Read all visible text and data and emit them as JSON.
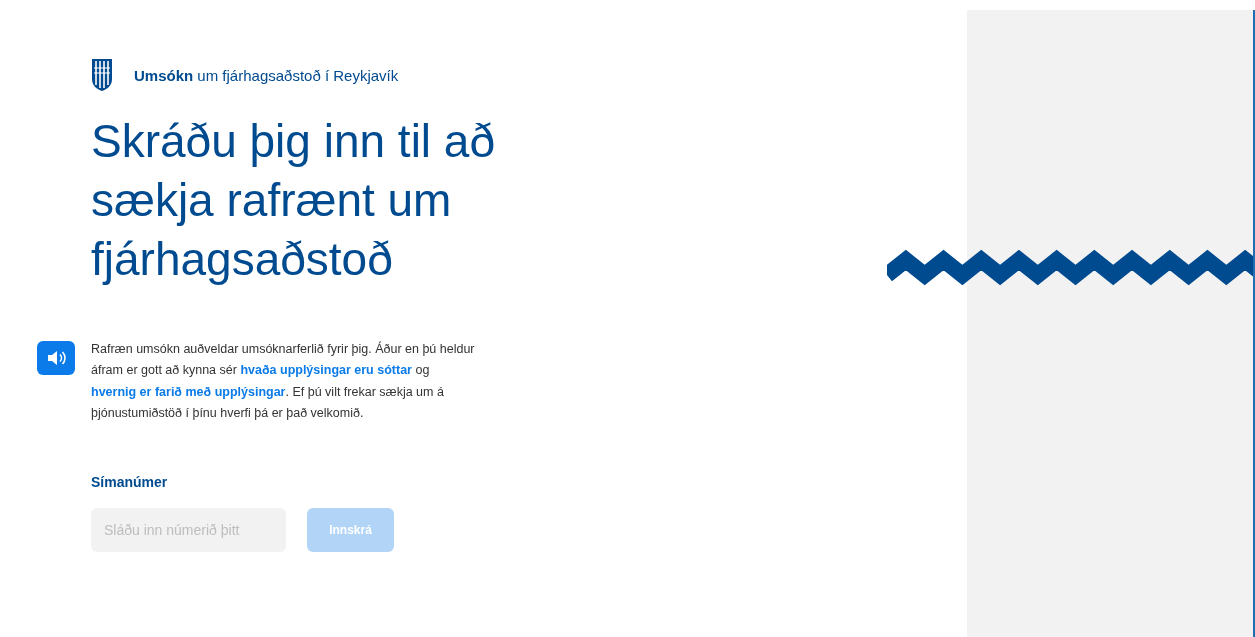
{
  "header": {
    "brand_bold": "Umsókn",
    "brand_rest": "um fjárhagsaðstoð í Reykjavík"
  },
  "title": "Skráðu þig inn til að sækja rafrænt um fjárhagsaðstoð",
  "intro": [
    {
      "kind": "text",
      "text": "Rafræn umsókn auðveldar umsóknarferlið fyrir þig. Áður en þú heldur áfram er gott að kynna sér "
    },
    {
      "kind": "link",
      "text": "hvaða upplýsingar eru sóttar"
    },
    {
      "kind": "text",
      "text": " og "
    },
    {
      "kind": "link",
      "text": "hvernig er farið með upplýsingar"
    },
    {
      "kind": "text",
      "text": ". Ef þú vilt frekar sækja um á þjónustumiðstöð í þínu hverfi þá er það velkomið."
    }
  ],
  "phone": {
    "label": "Símanúmer",
    "placeholder": "Sláðu inn númerið þitt"
  },
  "login_button": {
    "label": "Innskrá",
    "disabled": true
  }
}
